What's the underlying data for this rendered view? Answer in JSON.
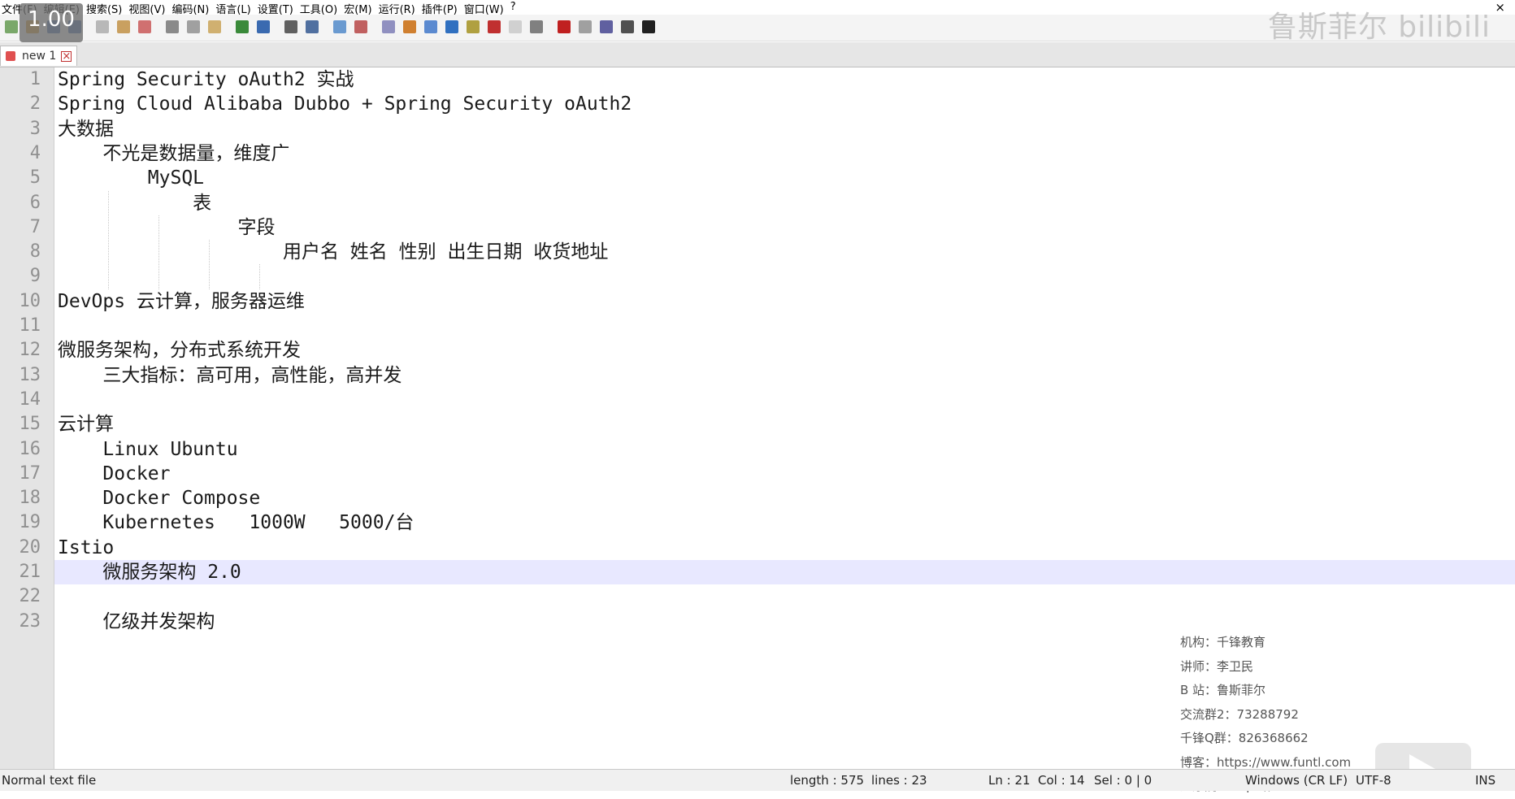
{
  "menu": [
    "文件(F)",
    "编辑(E)",
    "搜索(S)",
    "视图(V)",
    "编码(N)",
    "语言(L)",
    "设置(T)",
    "工具(O)",
    "宏(M)",
    "运行(R)",
    "插件(P)",
    "窗口(W)",
    "?"
  ],
  "close_glyph": "×",
  "speed_badge": "1.00",
  "watermark": "鲁斯菲尔 bilibili",
  "tab": {
    "name": "new 1",
    "close": "×"
  },
  "lines": [
    {
      "n": "1",
      "text": "Spring Security oAuth2 实战"
    },
    {
      "n": "2",
      "text": "Spring Cloud Alibaba Dubbo + Spring Security oAuth2"
    },
    {
      "n": "3",
      "text": "大数据"
    },
    {
      "n": "4",
      "text": "    不光是数据量，维度广"
    },
    {
      "n": "5",
      "text": "        MySQL"
    },
    {
      "n": "6",
      "text": "            表"
    },
    {
      "n": "7",
      "text": "                字段"
    },
    {
      "n": "8",
      "text": "                    用户名 姓名 性别 出生日期 收货地址"
    },
    {
      "n": "9",
      "text": ""
    },
    {
      "n": "10",
      "text": "DevOps 云计算，服务器运维"
    },
    {
      "n": "11",
      "text": ""
    },
    {
      "n": "12",
      "text": "微服务架构，分布式系统开发"
    },
    {
      "n": "13",
      "text": "    三大指标：高可用，高性能，高并发"
    },
    {
      "n": "14",
      "text": ""
    },
    {
      "n": "15",
      "text": "云计算"
    },
    {
      "n": "16",
      "text": "    Linux Ubuntu"
    },
    {
      "n": "17",
      "text": "    Docker"
    },
    {
      "n": "18",
      "text": "    Docker Compose"
    },
    {
      "n": "19",
      "text": "    Kubernetes   1000W   5000/台"
    },
    {
      "n": "20",
      "text": "Istio"
    },
    {
      "n": "21",
      "text": "    微服务架构 2.0"
    },
    {
      "n": "22",
      "text": ""
    },
    {
      "n": "23",
      "text": "    亿级并发架构"
    }
  ],
  "info": [
    "机构：千锋教育",
    "讲师：李卫民",
    "B 站：鲁斯菲尔",
    "交流群2：73288792",
    "千锋Q群：826368662",
    "博客：https://www.funtl.com",
    "达摩院：https://www.funtl.com"
  ],
  "status": {
    "type": "Normal text file",
    "length": "length : 575",
    "lines": "lines : 23",
    "ln": "Ln : 21",
    "col": "Col : 14",
    "sel": "Sel : 0 | 0",
    "eol": "Windows (CR LF)",
    "enc": "UTF-8",
    "mode": "INS"
  }
}
